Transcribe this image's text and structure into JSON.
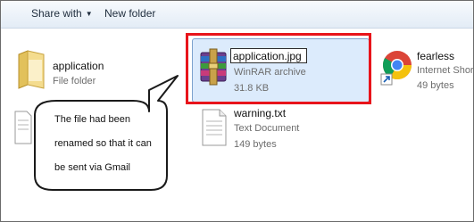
{
  "toolbar": {
    "share_label": "Share with",
    "share_arrow": "▼",
    "new_folder_label": "New folder"
  },
  "files": {
    "application_folder": {
      "name": "application",
      "type": "File folder",
      "icon": "folder-icon"
    },
    "application_archive": {
      "name": "application.jpg",
      "type": "WinRAR archive",
      "size": "31.8 KB",
      "icon": "winrar-archive-icon"
    },
    "fearless": {
      "name": "fearless",
      "type": "Internet Shortcut",
      "size": "49 bytes",
      "icon": "chrome-icon"
    },
    "warning": {
      "name": "warning.txt",
      "type": "Text Document",
      "size": "149 bytes",
      "icon": "text-document-icon"
    },
    "hidden_doc": {
      "icon": "text-document-icon"
    }
  },
  "callout": {
    "text": "The file had been\nrenamed so that it can\nbe sent via Gmail"
  },
  "colors": {
    "highlight_border": "#e8141b",
    "selection_fill": "#dcebfc",
    "selection_border": "#7da2ce"
  }
}
